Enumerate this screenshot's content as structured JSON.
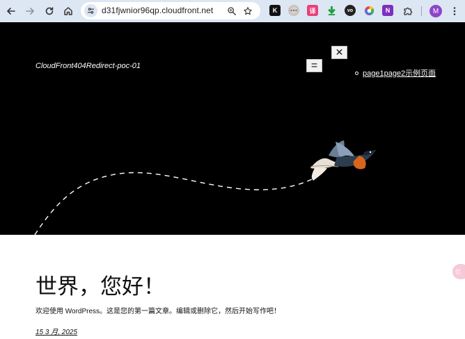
{
  "browser": {
    "url": "d31fjwnior96qp.cloudfront.net",
    "profile_initial": "M",
    "icons": {
      "back": "arrow-left-icon",
      "forward": "arrow-right-icon",
      "reload": "reload-icon",
      "home": "home-icon",
      "site_info": "tune-icon",
      "zoom": "zoom-icon",
      "bookmark": "star-icon",
      "extensions": "puzzle-icon",
      "menu": "kebab-menu-icon"
    },
    "extensions": [
      {
        "name": "kagi-extension-icon",
        "glyph": "K",
        "bg": "#111111",
        "fg": "#ffffff"
      },
      {
        "name": "raccoon-extension-icon",
        "glyph": "",
        "bg": "#c9c2bd",
        "fg": "#555555"
      },
      {
        "name": "translate-extension-icon",
        "glyph": "译",
        "bg": "#e8407a",
        "fg": "#ffffff"
      },
      {
        "name": "download-extension-icon",
        "glyph": "",
        "bg": "transparent",
        "fg": "#1e9e3a"
      },
      {
        "name": "vo-extension-icon",
        "glyph": "vo",
        "bg": "#222222",
        "fg": "#ffffff"
      },
      {
        "name": "color-extension-icon",
        "glyph": "",
        "bg": "transparent",
        "fg": "#000000"
      },
      {
        "name": "onenote-extension-icon",
        "glyph": "N",
        "bg": "#7b2fbe",
        "fg": "#ffffff"
      }
    ],
    "colors": {
      "toolbar": "#dde6f3",
      "profile": "#8e44c9"
    }
  },
  "site": {
    "title": "CloudFront404Redirect-poc-01",
    "close_glyph": "✕",
    "menu_glyph": "=",
    "nav_items": [
      "page1page2示例页面"
    ]
  },
  "post": {
    "title": "世界，您好！",
    "excerpt": "欢迎使用 WordPress。这是您的第一篇文章。编辑或删除它，然后开始写作吧！",
    "date": "15 3 月, 2025"
  },
  "floating_badge": {
    "glyph": "亿",
    "icon": "chat-bubble-icon"
  }
}
